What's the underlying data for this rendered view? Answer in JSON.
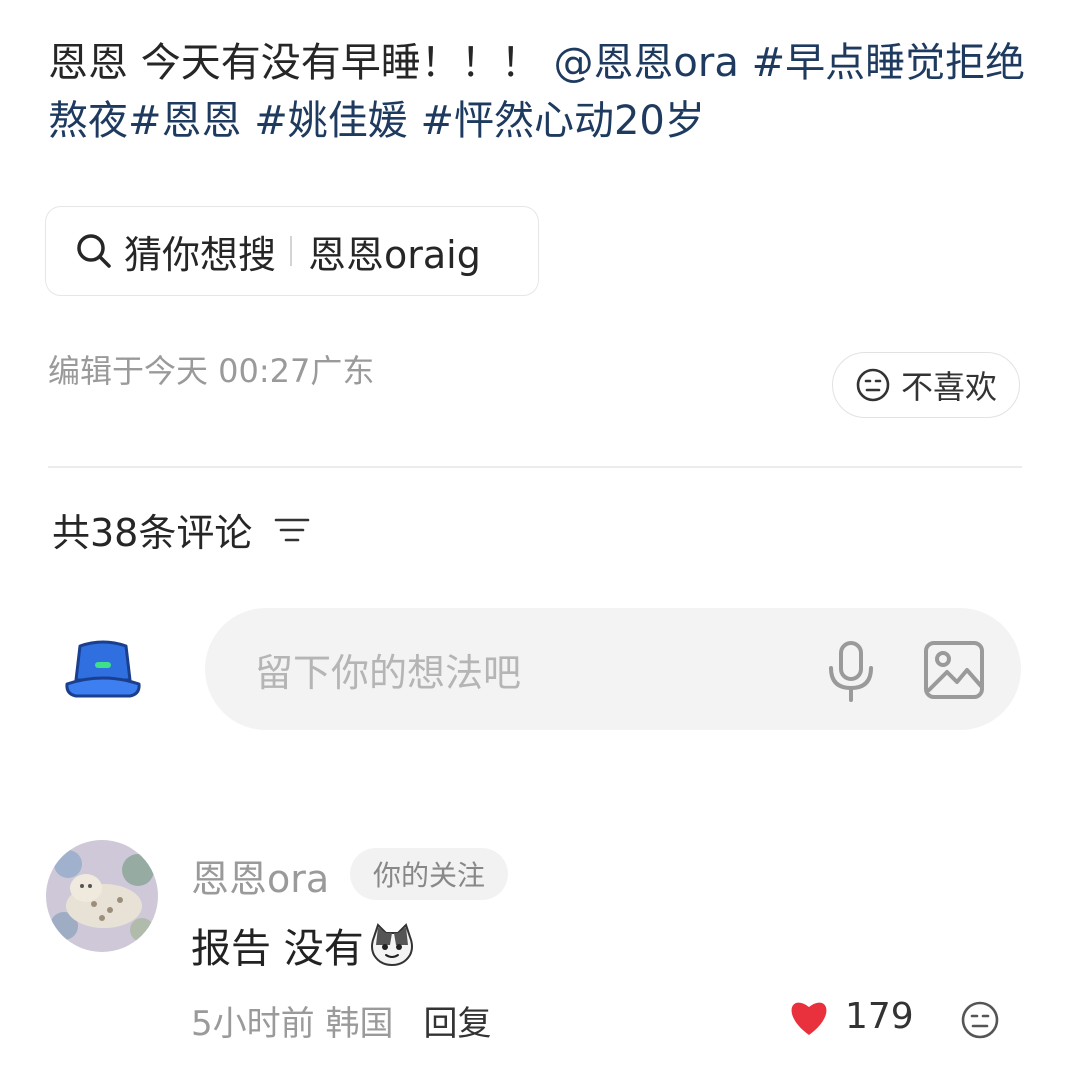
{
  "post": {
    "text_plain": "恩恩 今天有没有早睡！！！ ",
    "mention": "@恩恩ora",
    "tags": [
      "#早点睡觉拒绝熬夜#",
      "恩恩",
      " #姚佳媛",
      " #怦然心动20岁"
    ]
  },
  "search": {
    "prefix": "猜你想搜",
    "keyword": "恩恩oraig"
  },
  "meta": {
    "edited": "编辑于今天 00:27广东"
  },
  "dislike": {
    "label": "不喜欢"
  },
  "comments_header": {
    "label": "共38条评论"
  },
  "comment_input": {
    "placeholder": "留下你的想法吧"
  },
  "comments": [
    {
      "author": "恩恩ora",
      "badge": "你的关注",
      "body": "报告 没有",
      "time_location": "5小时前 韩国",
      "reply_label": "回复",
      "likes": "179"
    }
  ],
  "colors": {
    "tag": "#1e3a5f",
    "like_heart": "#e8313c",
    "avatar_hat": "#2f6fe0"
  },
  "icons": [
    "search-icon",
    "neutral-face-icon",
    "sort-icon",
    "bucket-hat-avatar-icon",
    "microphone-icon",
    "image-icon",
    "heart-icon",
    "cat-emoji-icon"
  ]
}
